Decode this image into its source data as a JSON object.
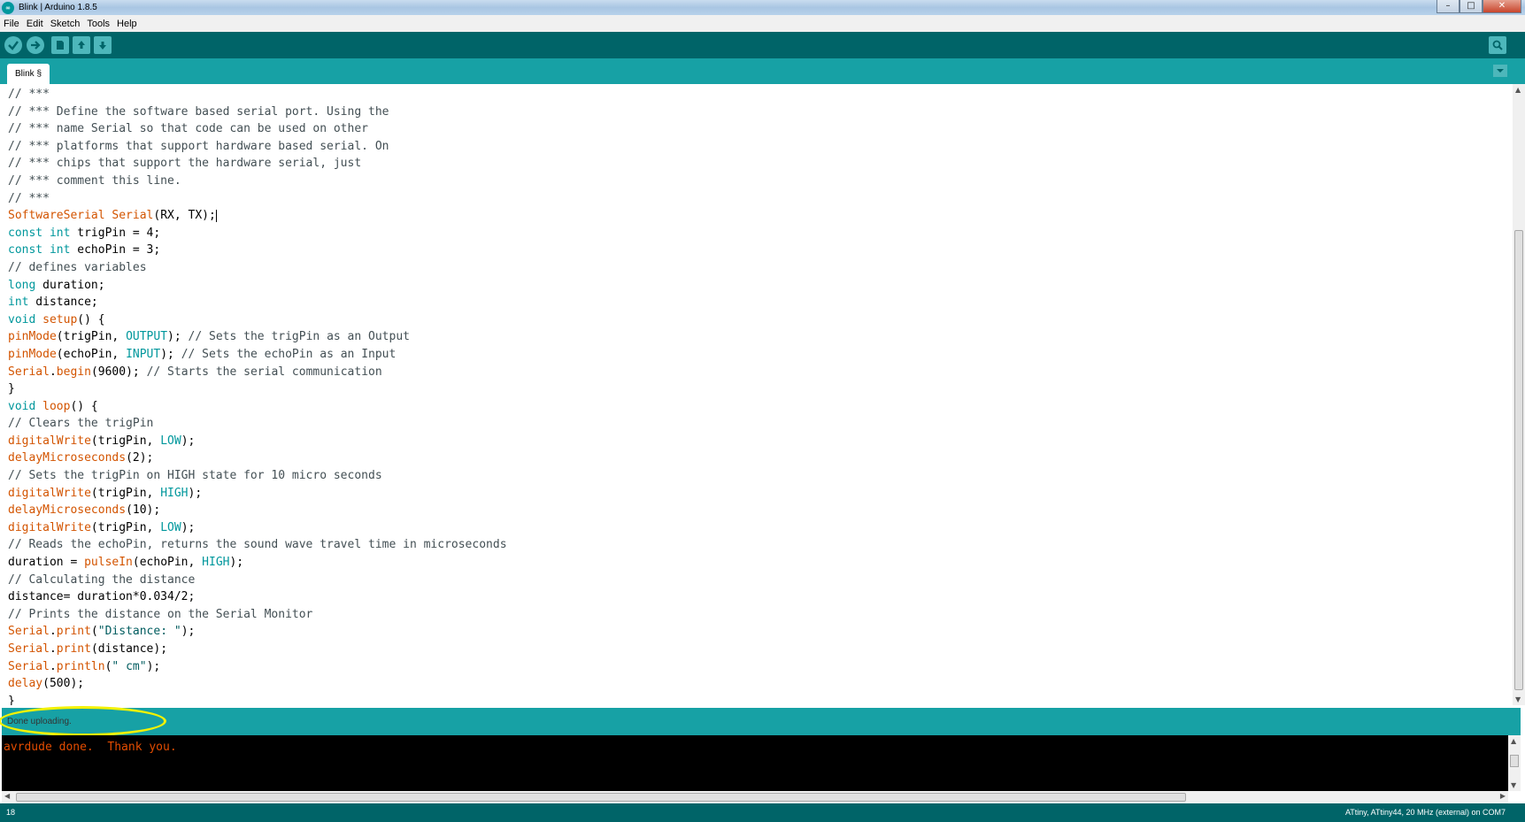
{
  "window": {
    "title": "Blink | Arduino 1.8.5",
    "controls": [
      "minimize",
      "maximize",
      "close"
    ]
  },
  "menu": [
    "File",
    "Edit",
    "Sketch",
    "Tools",
    "Help"
  ],
  "toolbar": {
    "buttons": [
      "verify-icon",
      "upload-icon",
      "new-icon",
      "open-icon",
      "save-icon"
    ],
    "right_button": "serial-monitor-icon"
  },
  "tab": {
    "label": "Blink §"
  },
  "code": [
    [
      [
        "cm",
        "// ***"
      ]
    ],
    [
      [
        "cm",
        "// *** Define the software based serial port. Using the"
      ]
    ],
    [
      [
        "cm",
        "// *** name Serial so that code can be used on other"
      ]
    ],
    [
      [
        "cm",
        "// *** platforms that support hardware based serial. On"
      ]
    ],
    [
      [
        "cm",
        "// *** chips that support the hardware serial, just"
      ]
    ],
    [
      [
        "cm",
        "// *** comment this line."
      ]
    ],
    [
      [
        "cm",
        "// ***"
      ]
    ],
    [
      [
        "kw",
        "SoftwareSerial Serial"
      ],
      [
        "plain",
        "(RX, TX);"
      ]
    ],
    [
      [
        "type",
        "const int"
      ],
      [
        "plain",
        " trigPin = 4;"
      ]
    ],
    [
      [
        "type",
        "const int"
      ],
      [
        "plain",
        " echoPin = 3;"
      ]
    ],
    [
      [
        "cm",
        "// defines variables"
      ]
    ],
    [
      [
        "type",
        "long"
      ],
      [
        "plain",
        " duration;"
      ]
    ],
    [
      [
        "type",
        "int"
      ],
      [
        "plain",
        " distance;"
      ]
    ],
    [
      [
        "type",
        "void"
      ],
      [
        "plain",
        " "
      ],
      [
        "kw",
        "setup"
      ],
      [
        "plain",
        "() {"
      ]
    ],
    [
      [
        "kw",
        "pinMode"
      ],
      [
        "plain",
        "(trigPin, "
      ],
      [
        "const",
        "OUTPUT"
      ],
      [
        "plain",
        "); "
      ],
      [
        "cm",
        "// Sets the trigPin as an Output"
      ]
    ],
    [
      [
        "kw",
        "pinMode"
      ],
      [
        "plain",
        "(echoPin, "
      ],
      [
        "const",
        "INPUT"
      ],
      [
        "plain",
        "); "
      ],
      [
        "cm",
        "// Sets the echoPin as an Input"
      ]
    ],
    [
      [
        "kw",
        "Serial"
      ],
      [
        "plain",
        "."
      ],
      [
        "kw",
        "begin"
      ],
      [
        "plain",
        "(9600); "
      ],
      [
        "cm",
        "// Starts the serial communication"
      ]
    ],
    [
      [
        "plain",
        "}"
      ]
    ],
    [
      [
        "type",
        "void"
      ],
      [
        "plain",
        " "
      ],
      [
        "kw",
        "loop"
      ],
      [
        "plain",
        "() {"
      ]
    ],
    [
      [
        "cm",
        "// Clears the trigPin"
      ]
    ],
    [
      [
        "kw",
        "digitalWrite"
      ],
      [
        "plain",
        "(trigPin, "
      ],
      [
        "const",
        "LOW"
      ],
      [
        "plain",
        ");"
      ]
    ],
    [
      [
        "kw",
        "delayMicroseconds"
      ],
      [
        "plain",
        "(2);"
      ]
    ],
    [
      [
        "cm",
        "// Sets the trigPin on HIGH state for 10 micro seconds"
      ]
    ],
    [
      [
        "kw",
        "digitalWrite"
      ],
      [
        "plain",
        "(trigPin, "
      ],
      [
        "const",
        "HIGH"
      ],
      [
        "plain",
        ");"
      ]
    ],
    [
      [
        "kw",
        "delayMicroseconds"
      ],
      [
        "plain",
        "(10);"
      ]
    ],
    [
      [
        "kw",
        "digitalWrite"
      ],
      [
        "plain",
        "(trigPin, "
      ],
      [
        "const",
        "LOW"
      ],
      [
        "plain",
        ");"
      ]
    ],
    [
      [
        "cm",
        "// Reads the echoPin, returns the sound wave travel time in microseconds"
      ]
    ],
    [
      [
        "plain",
        "duration = "
      ],
      [
        "kw",
        "pulseIn"
      ],
      [
        "plain",
        "(echoPin, "
      ],
      [
        "const",
        "HIGH"
      ],
      [
        "plain",
        ");"
      ]
    ],
    [
      [
        "cm",
        "// Calculating the distance"
      ]
    ],
    [
      [
        "plain",
        "distance= duration*0.034/2;"
      ]
    ],
    [
      [
        "cm",
        "// Prints the distance on the Serial Monitor"
      ]
    ],
    [
      [
        "kw",
        "Serial"
      ],
      [
        "plain",
        "."
      ],
      [
        "kw",
        "print"
      ],
      [
        "plain",
        "("
      ],
      [
        "str",
        "\"Distance: \""
      ],
      [
        "plain",
        ");"
      ]
    ],
    [
      [
        "kw",
        "Serial"
      ],
      [
        "plain",
        "."
      ],
      [
        "kw",
        "print"
      ],
      [
        "plain",
        "(distance);"
      ]
    ],
    [
      [
        "kw",
        "Serial"
      ],
      [
        "plain",
        "."
      ],
      [
        "kw",
        "println"
      ],
      [
        "plain",
        "("
      ],
      [
        "str",
        "\" cm\""
      ],
      [
        "plain",
        ");"
      ]
    ],
    [
      [
        "kw",
        "delay"
      ],
      [
        "plain",
        "(500);"
      ]
    ],
    [
      [
        "plain",
        "}"
      ]
    ]
  ],
  "status": {
    "message": "Done uploading."
  },
  "console": {
    "output": "avrdude done.  Thank you."
  },
  "footer": {
    "line_number": "18",
    "board": "ATtiny, ATtiny44, 20 MHz (external) on COM7"
  },
  "colors": {
    "toolbar": "#006468",
    "tabbar": "#17a1a5",
    "highlight": "#f4f100",
    "console_text": "#e34c00"
  }
}
